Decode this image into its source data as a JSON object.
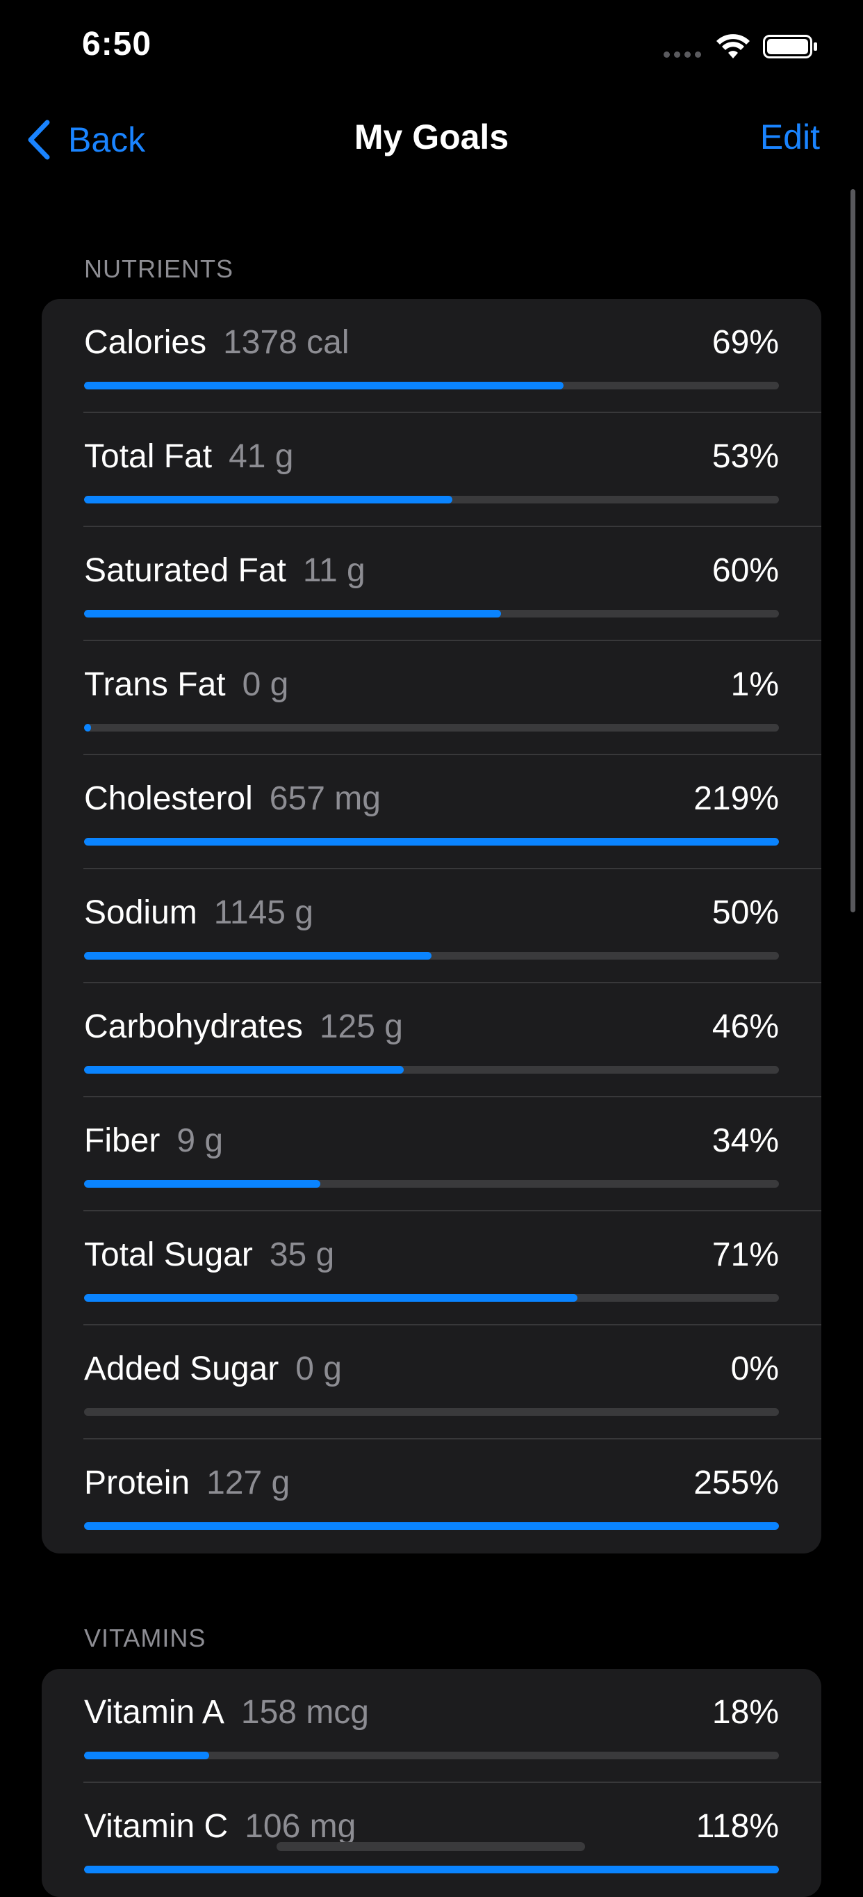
{
  "status_bar": {
    "time": "6:50"
  },
  "nav": {
    "back_label": "Back",
    "title": "My Goals",
    "edit_label": "Edit"
  },
  "colors": {
    "accent": "#0a84ff",
    "background": "#000000",
    "card": "#1c1c1e",
    "secondary_text": "#8d8d93",
    "track": "#3a3a3c"
  },
  "sections": [
    {
      "header": "NUTRIENTS",
      "rows": [
        {
          "name": "Calories",
          "amount": "1378 cal",
          "percent": "69%",
          "progress": 0.69
        },
        {
          "name": "Total Fat",
          "amount": "41 g",
          "percent": "53%",
          "progress": 0.53
        },
        {
          "name": "Saturated Fat",
          "amount": "11 g",
          "percent": "60%",
          "progress": 0.6
        },
        {
          "name": "Trans Fat",
          "amount": "0 g",
          "percent": "1%",
          "progress": 0.01
        },
        {
          "name": "Cholesterol",
          "amount": "657 mg",
          "percent": "219%",
          "progress": 1.0
        },
        {
          "name": "Sodium",
          "amount": "1145 g",
          "percent": "50%",
          "progress": 0.5
        },
        {
          "name": "Carbohydrates",
          "amount": "125 g",
          "percent": "46%",
          "progress": 0.46
        },
        {
          "name": "Fiber",
          "amount": "9 g",
          "percent": "34%",
          "progress": 0.34
        },
        {
          "name": "Total Sugar",
          "amount": "35 g",
          "percent": "71%",
          "progress": 0.71
        },
        {
          "name": "Added Sugar",
          "amount": "0 g",
          "percent": "0%",
          "progress": 0.0
        },
        {
          "name": "Protein",
          "amount": "127 g",
          "percent": "255%",
          "progress": 1.0
        }
      ]
    },
    {
      "header": "VITAMINS",
      "rows": [
        {
          "name": "Vitamin A",
          "amount": "158 mcg",
          "percent": "18%",
          "progress": 0.18
        },
        {
          "name": "Vitamin C",
          "amount": "106 mg",
          "percent": "118%",
          "progress": 1.0
        }
      ]
    }
  ]
}
